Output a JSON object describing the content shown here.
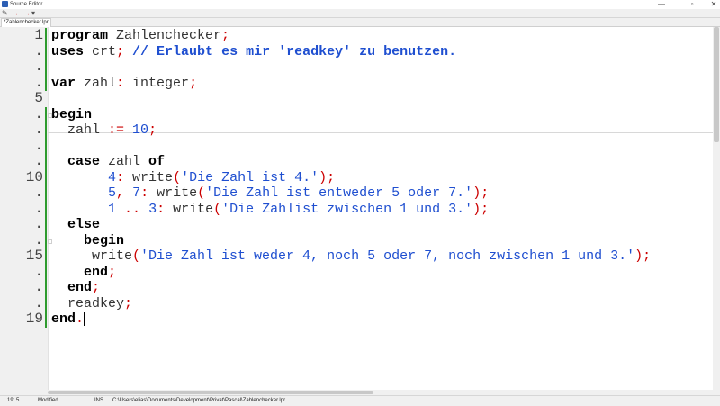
{
  "window": {
    "title": "Source Editor",
    "minimize": "—",
    "maximize": "▫",
    "close": "✕"
  },
  "toolbar": {
    "buttons": [
      {
        "name": "edit-icon",
        "glyph": "✎"
      },
      {
        "name": "back-arrow-icon",
        "glyph": "←"
      },
      {
        "name": "forward-arrow-icon",
        "glyph": "→"
      },
      {
        "name": "menu-icon",
        "glyph": "▾"
      }
    ],
    "accent": "#cc2222"
  },
  "tab": {
    "label": "*Zahlenchecker.lpr"
  },
  "editor": {
    "line_numbers": [
      "1",
      ".",
      ".",
      ".",
      "5",
      ".",
      ".",
      ".",
      ".",
      "10",
      ".",
      ".",
      ".",
      ".",
      "15",
      ".",
      ".",
      ".",
      "19"
    ],
    "lines": [
      [
        {
          "t": "program",
          "c": "kw"
        },
        {
          "t": " Zahlenchecker",
          "c": "id"
        },
        {
          "t": ";",
          "c": "sym"
        }
      ],
      [
        {
          "t": "uses",
          "c": "kw"
        },
        {
          "t": " crt",
          "c": "id"
        },
        {
          "t": ";",
          "c": "sym"
        },
        {
          "t": " // Erlaubt es mir 'readkey' zu benutzen.",
          "c": "com"
        }
      ],
      [],
      [
        {
          "t": "var",
          "c": "kw"
        },
        {
          "t": " zahl",
          "c": "id"
        },
        {
          "t": ":",
          "c": "sym"
        },
        {
          "t": " integer",
          "c": "id"
        },
        {
          "t": ";",
          "c": "sym"
        }
      ],
      [],
      [
        {
          "t": "begin",
          "c": "kw"
        }
      ],
      [
        {
          "t": "  zahl ",
          "c": "id"
        },
        {
          "t": ":=",
          "c": "sym"
        },
        {
          "t": " ",
          "c": "id"
        },
        {
          "t": "10",
          "c": "num"
        },
        {
          "t": ";",
          "c": "sym"
        }
      ],
      [],
      [
        {
          "t": "  case",
          "c": "kw"
        },
        {
          "t": " zahl ",
          "c": "id"
        },
        {
          "t": "of",
          "c": "kw"
        }
      ],
      [
        {
          "t": "       ",
          "c": "id"
        },
        {
          "t": "4",
          "c": "num"
        },
        {
          "t": ":",
          "c": "sym"
        },
        {
          "t": " write",
          "c": "id"
        },
        {
          "t": "(",
          "c": "sym"
        },
        {
          "t": "'Die Zahl ist 4.'",
          "c": "str"
        },
        {
          "t": ");",
          "c": "sym"
        }
      ],
      [
        {
          "t": "       ",
          "c": "id"
        },
        {
          "t": "5",
          "c": "num"
        },
        {
          "t": ",",
          "c": "sym"
        },
        {
          "t": " ",
          "c": "id"
        },
        {
          "t": "7",
          "c": "num"
        },
        {
          "t": ":",
          "c": "sym"
        },
        {
          "t": " write",
          "c": "id"
        },
        {
          "t": "(",
          "c": "sym"
        },
        {
          "t": "'Die Zahl ist entweder 5 oder 7.'",
          "c": "str"
        },
        {
          "t": ");",
          "c": "sym"
        }
      ],
      [
        {
          "t": "       ",
          "c": "id"
        },
        {
          "t": "1",
          "c": "num"
        },
        {
          "t": " ..",
          "c": "sym"
        },
        {
          "t": " ",
          "c": "id"
        },
        {
          "t": "3",
          "c": "num"
        },
        {
          "t": ":",
          "c": "sym"
        },
        {
          "t": " write",
          "c": "id"
        },
        {
          "t": "(",
          "c": "sym"
        },
        {
          "t": "'Die Zahlist zwischen 1 und 3.'",
          "c": "str"
        },
        {
          "t": ");",
          "c": "sym"
        }
      ],
      [
        {
          "t": "  else",
          "c": "kw"
        }
      ],
      [
        {
          "t": "    begin",
          "c": "kw"
        }
      ],
      [
        {
          "t": "     write",
          "c": "id"
        },
        {
          "t": "(",
          "c": "sym"
        },
        {
          "t": "'Die Zahl ist weder 4, noch 5 oder 7, noch zwischen 1 und 3.'",
          "c": "str"
        },
        {
          "t": ");",
          "c": "sym"
        }
      ],
      [
        {
          "t": "    end",
          "c": "kw"
        },
        {
          "t": ";",
          "c": "sym"
        }
      ],
      [
        {
          "t": "  end",
          "c": "kw"
        },
        {
          "t": ";",
          "c": "sym"
        }
      ],
      [
        {
          "t": "  readkey",
          "c": "id"
        },
        {
          "t": ";",
          "c": "sym"
        }
      ],
      [
        {
          "t": "end",
          "c": "kw"
        },
        {
          "t": ".",
          "c": "sym"
        }
      ]
    ],
    "modified_lines": [
      0,
      1,
      2,
      3,
      5,
      6,
      7,
      8,
      9,
      10,
      11,
      12,
      13,
      14,
      15,
      16,
      17,
      18
    ],
    "colors": {
      "keyword": "#000000",
      "symbol": "#cc0000",
      "string": "#1f4fd0",
      "comment": "#1f4fd0",
      "modified_marker": "#2e9b2e"
    }
  },
  "status": {
    "position": "19: 5",
    "state": "Modified",
    "mode": "INS",
    "file_path": "C:\\Users\\elias\\Documents\\Development\\Privat\\Pascal\\Zahlenchecker.lpr"
  }
}
